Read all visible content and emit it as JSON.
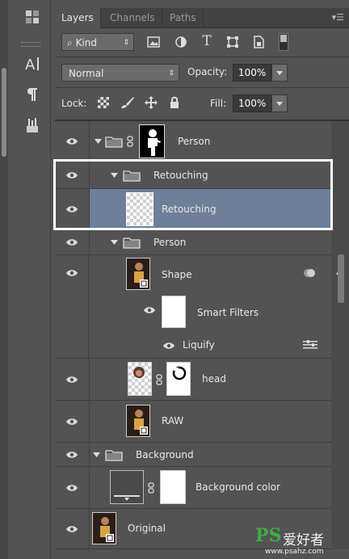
{
  "tabs": [
    {
      "label": "Layers",
      "active": true
    },
    {
      "label": "Channels",
      "active": false
    },
    {
      "label": "Paths",
      "active": false
    }
  ],
  "filter": {
    "kind_label": "Kind"
  },
  "blend": {
    "mode": "Normal",
    "opacity_label": "Opacity:",
    "opacity_value": "100%"
  },
  "lock": {
    "lock_label": "Lock:",
    "fill_label": "Fill:",
    "fill_value": "100%"
  },
  "layers": [
    {
      "name": "Person",
      "kind": "group-with-mask",
      "expanded": true
    },
    {
      "name": "Retouching",
      "kind": "group",
      "expanded": true
    },
    {
      "name": "Retouching",
      "kind": "layer",
      "selected": true
    },
    {
      "name": "Person",
      "kind": "group",
      "expanded": true
    },
    {
      "name": "Shape",
      "kind": "smart-object"
    },
    {
      "name": "Smart Filters",
      "kind": "smart-filters"
    },
    {
      "name": "Liquify",
      "kind": "filter"
    },
    {
      "name": "head",
      "kind": "layer-with-mask"
    },
    {
      "name": "RAW",
      "kind": "smart-object"
    },
    {
      "name": "Background",
      "kind": "group",
      "expanded": true
    },
    {
      "name": "Background color",
      "kind": "fill-layer-with-mask"
    },
    {
      "name": "Original",
      "kind": "smart-object"
    }
  ],
  "watermark": {
    "brand": "PS",
    "cn_text": "爱好者",
    "url": "www.psahz.com"
  },
  "colors": {
    "panel": "#535353",
    "selected": "#6d7f99",
    "highlight": "#ffffff"
  }
}
